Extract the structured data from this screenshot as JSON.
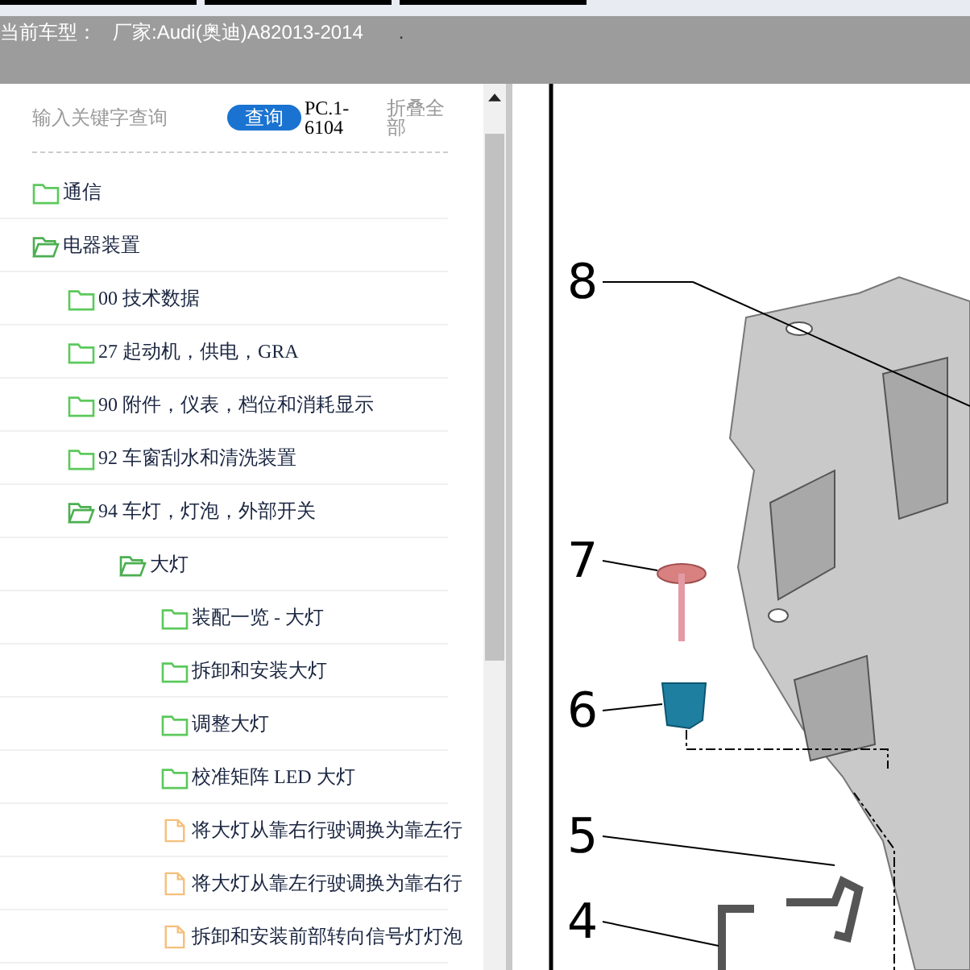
{
  "header": {
    "label": "当前车型：",
    "model": "厂家:Audi(奥迪)A82013-2014",
    "dot": "."
  },
  "search": {
    "placeholder": "输入关键字查询",
    "button": "查询",
    "code": "PC.1-6104",
    "collapse": "折叠全部"
  },
  "tree": [
    {
      "kind": "folder",
      "label": "通信",
      "expanded": false
    },
    {
      "kind": "folder",
      "label": "电器装置",
      "expanded": true,
      "children": [
        {
          "kind": "folder",
          "label": "00 技术数据",
          "expanded": false
        },
        {
          "kind": "folder",
          "label": "27 起动机，供电，GRA",
          "expanded": false
        },
        {
          "kind": "folder",
          "label": "90 附件，仪表，档位和消耗显示",
          "expanded": false
        },
        {
          "kind": "folder",
          "label": "92 车窗刮水和清洗装置",
          "expanded": false
        },
        {
          "kind": "folder",
          "label": "94 车灯，灯泡，外部开关",
          "expanded": true,
          "children": [
            {
              "kind": "folder",
              "label": "大灯",
              "expanded": true,
              "children": [
                {
                  "kind": "folder",
                  "label": "装配一览 - 大灯",
                  "expanded": false
                },
                {
                  "kind": "folder",
                  "label": "拆卸和安装大灯",
                  "expanded": false
                },
                {
                  "kind": "folder",
                  "label": "调整大灯",
                  "expanded": false
                },
                {
                  "kind": "folder",
                  "label": "校准矩阵 LED 大灯",
                  "expanded": false
                },
                {
                  "kind": "file",
                  "label": "将大灯从靠右行驶调换为靠左行"
                },
                {
                  "kind": "file",
                  "label": "将大灯从靠左行驶调换为靠右行"
                },
                {
                  "kind": "file",
                  "label": "拆卸和安装前部转向信号灯灯泡"
                }
              ]
            }
          ]
        }
      ]
    }
  ],
  "diagram": {
    "callouts": [
      "8",
      "7",
      "6",
      "5",
      "4"
    ]
  }
}
